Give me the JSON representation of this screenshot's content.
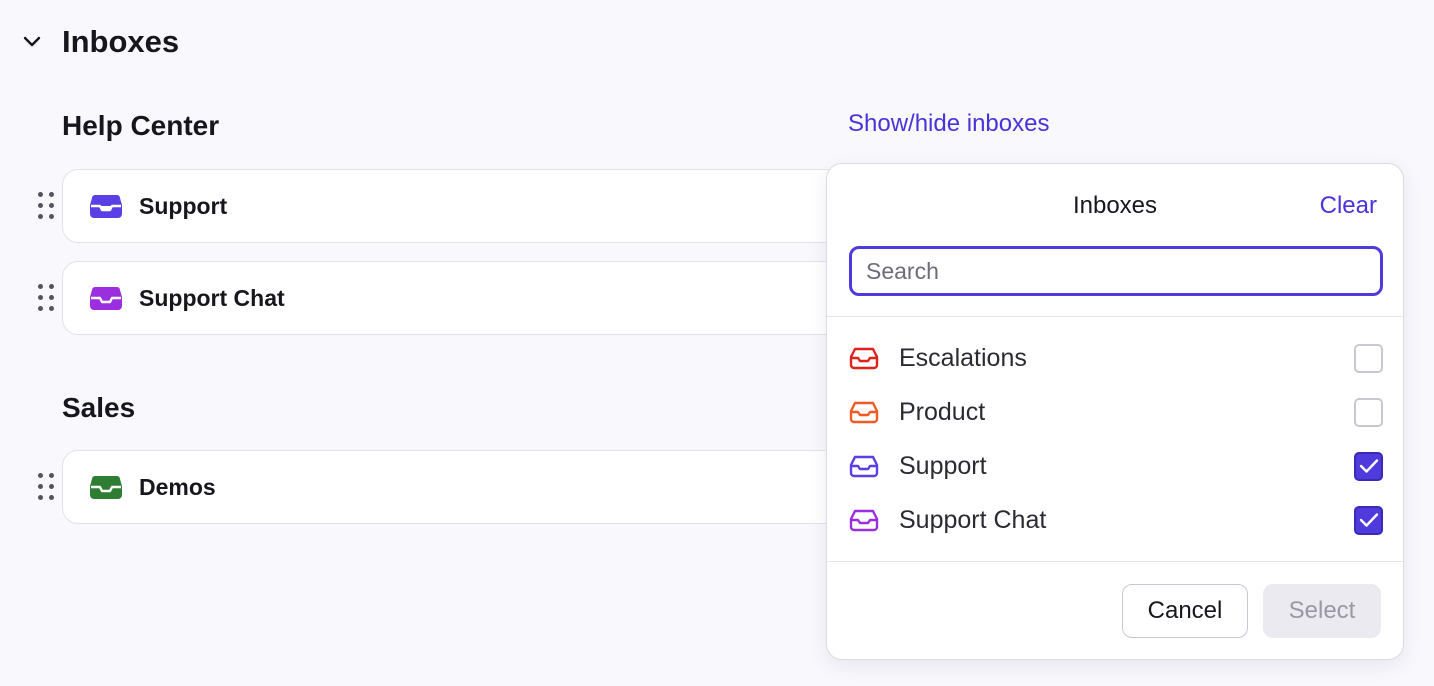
{
  "section": {
    "title": "Inboxes"
  },
  "groups": [
    {
      "title": "Help Center",
      "inboxes": [
        {
          "label": "Support",
          "color": "#5a3ee6"
        },
        {
          "label": "Support Chat",
          "color": "#9b2fe0"
        }
      ]
    },
    {
      "title": "Sales",
      "inboxes": [
        {
          "label": "Demos",
          "color": "#2e7d32"
        }
      ]
    }
  ],
  "show_hide_link": "Show/hide inboxes",
  "popover": {
    "title": "Inboxes",
    "clear_label": "Clear",
    "search_placeholder": "Search",
    "search_value": "",
    "options": [
      {
        "label": "Escalations",
        "color": "#e0211c",
        "checked": false
      },
      {
        "label": "Product",
        "color": "#ef5b25",
        "checked": false
      },
      {
        "label": "Support",
        "color": "#5a3ee6",
        "checked": true
      },
      {
        "label": "Support Chat",
        "color": "#9b2fe0",
        "checked": true
      }
    ],
    "cancel_label": "Cancel",
    "select_label": "Select",
    "select_enabled": false
  },
  "icons": {
    "chevron": "chevron-down-icon",
    "drag": "drag-handle-icon",
    "inbox": "inbox-tray-icon",
    "check": "checkmark-icon"
  },
  "colors": {
    "accent": "#4f3bdc",
    "link": "#4a33d9"
  }
}
